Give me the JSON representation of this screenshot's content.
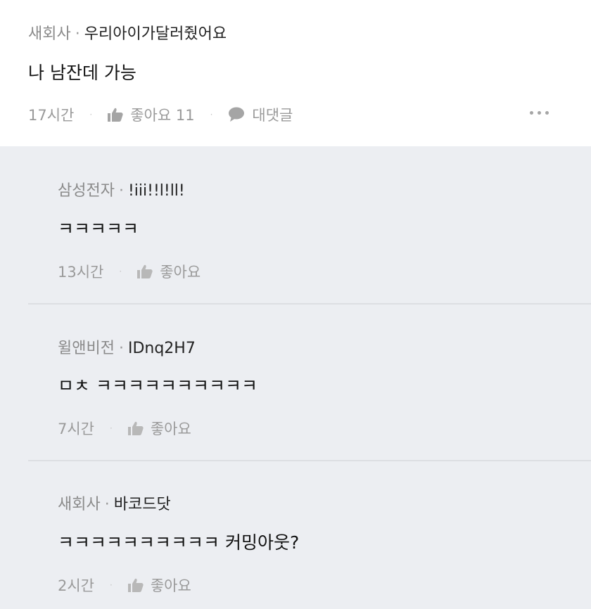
{
  "post": {
    "company": "새회사",
    "nickname": "우리아이가달러줬어요",
    "content": "나 남잔데 가능",
    "time": "17시간",
    "like_label": "좋아요 11",
    "reply_label": "대댓글"
  },
  "comments": [
    {
      "company": "삼성전자",
      "nickname": "!iii!!l!ll!",
      "content": "ㅋㅋㅋㅋㅋ",
      "time": "13시간",
      "like_label": "좋아요"
    },
    {
      "company": "윌앤비전",
      "nickname": "IDnq2H7",
      "content": "ㅁㅊ ㅋㅋㅋㅋㅋㅋㅋㅋㅋㅋ",
      "time": "7시간",
      "like_label": "좋아요"
    },
    {
      "company": "새회사",
      "nickname": "바코드닷",
      "content": "ㅋㅋㅋㅋㅋㅋㅋㅋㅋㅋ 커밍아웃?",
      "time": "2시간",
      "like_label": "좋아요"
    }
  ],
  "separator": "·",
  "icons": {
    "like": "thumbs-up-icon",
    "reply": "speech-bubble-icon",
    "more": "more-dots-icon"
  }
}
